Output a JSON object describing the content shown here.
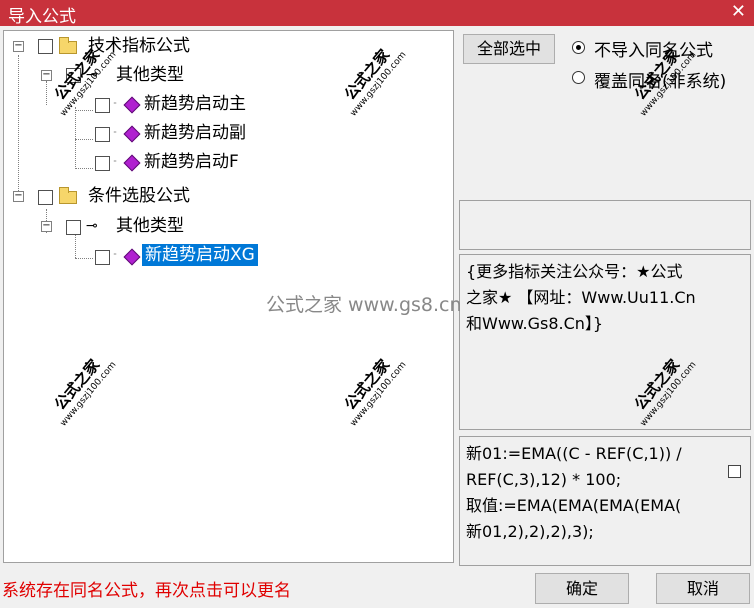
{
  "window": {
    "title": "导入公式",
    "close": "✕"
  },
  "tree": {
    "root1": {
      "label": "技术指标公式"
    },
    "group1": {
      "label": "其他类型"
    },
    "items1": [
      {
        "label": "新趋势启动主"
      },
      {
        "label": "新趋势启动副"
      },
      {
        "label": "新趋势启动F"
      }
    ],
    "root2": {
      "label": "条件选股公式"
    },
    "group2": {
      "label": "其他类型"
    },
    "items2": [
      {
        "label": "新趋势启动XG"
      }
    ]
  },
  "options": {
    "select_all": "全部选中",
    "no_import_same": "不导入同名公式",
    "overwrite_same": "覆盖同名(非系统)"
  },
  "description": {
    "line1": "{更多指标关注公众号：★公式",
    "line2": "之家★ 【网址：Www.Uu11.Cn",
    "line3": "和Www.Gs8.Cn】}"
  },
  "code": {
    "line1": "新01:=EMA((C - REF(C,1)) /",
    "line2": "REF(C,3),12) * 100;",
    "line3": "取值:=EMA(EMA(EMA(EMA(",
    "line4": "新01,2),2),2),3);"
  },
  "status": "系统存在同名公式，再次点击可以更名",
  "buttons": {
    "ok": "确定",
    "cancel": "取消"
  },
  "watermark": {
    "text": "公式之家",
    "url": "www.gszj100.com",
    "center": "公式之家 www.gs8.cn"
  }
}
